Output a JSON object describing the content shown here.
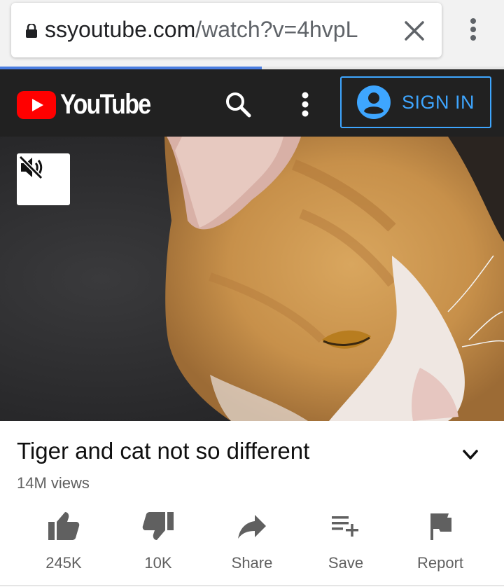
{
  "browser": {
    "url_domain": "ssyoutube.com",
    "url_path": "/watch?v=4hvpL",
    "load_progress_percent": 52
  },
  "header": {
    "logo_text": "YouTube",
    "sign_in_label": "SIGN IN"
  },
  "player": {
    "mute_icon": "volume-off-icon"
  },
  "video": {
    "title": "Tiger and cat not so different",
    "views": "14M views"
  },
  "actions": [
    {
      "label": "245K",
      "icon": "thumbs-up-icon"
    },
    {
      "label": "10K",
      "icon": "thumbs-down-icon"
    },
    {
      "label": "Share",
      "icon": "share-icon"
    },
    {
      "label": "Save",
      "icon": "playlist-add-icon"
    },
    {
      "label": "Report",
      "icon": "flag-icon"
    }
  ],
  "colors": {
    "brand_red": "#ff0000",
    "header_bg": "#212121",
    "sign_in_blue": "#3ea6ff",
    "progress_blue": "#4a7de0"
  }
}
